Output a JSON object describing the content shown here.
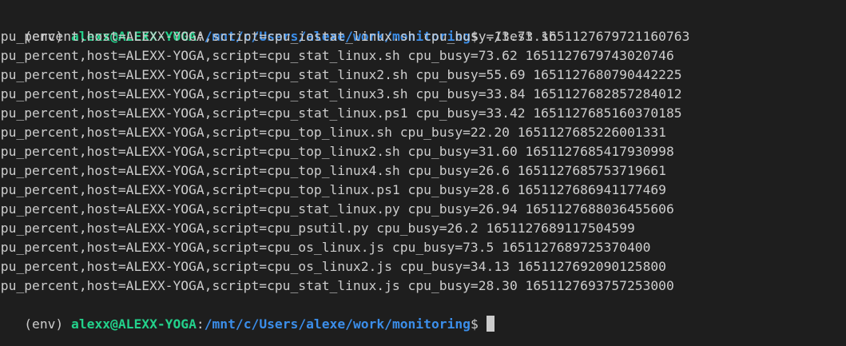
{
  "prompt": {
    "env": "(env)",
    "user_host": "alexx@ALEXX-YOGA",
    "colon": ":",
    "path": "/mnt/c/Users/alexe/work/monitoring",
    "dollar": "$",
    "command": " ./test.sh"
  },
  "output_lines": [
    "cpu_percent,host=ALEXX-YOGA,script=cpu_iostat_linux.sh cpu_busy=13.73 1651127679721160763",
    "cpu_percent,host=ALEXX-YOGA,script=cpu_stat_linux.sh cpu_busy=73.62 1651127679743020746",
    "cpu_percent,host=ALEXX-YOGA,script=cpu_stat_linux2.sh cpu_busy=55.69 1651127680790442225",
    "cpu_percent,host=ALEXX-YOGA,script=cpu_stat_linux3.sh cpu_busy=33.84 1651127682857284012",
    "cpu_percent,host=ALEXX-YOGA,script=cpu_stat_linux.ps1 cpu_busy=33.42 1651127685160370185",
    "cpu_percent,host=ALEXX-YOGA,script=cpu_top_linux.sh cpu_busy=22.20 1651127685226001331",
    "cpu_percent,host=ALEXX-YOGA,script=cpu_top_linux2.sh cpu_busy=31.60 1651127685417930998",
    "cpu_percent,host=ALEXX-YOGA,script=cpu_top_linux4.sh cpu_busy=26.6 1651127685753719661",
    "cpu_percent,host=ALEXX-YOGA,script=cpu_top_linux.ps1 cpu_busy=28.6 1651127686941177469",
    "cpu_percent,host=ALEXX-YOGA,script=cpu_stat_linux.py cpu_busy=26.94 1651127688036455606",
    "cpu_percent,host=ALEXX-YOGA,script=cpu_psutil.py cpu_busy=26.2 1651127689117504599",
    "cpu_percent,host=ALEXX-YOGA,script=cpu_os_linux.js cpu_busy=73.5 1651127689725370400",
    "cpu_percent,host=ALEXX-YOGA,script=cpu_os_linux2.js cpu_busy=34.13 1651127692090125800",
    "cpu_percent,host=ALEXX-YOGA,script=cpu_stat_linux.js cpu_busy=28.30 1651127693757253000"
  ],
  "colors": {
    "background": "#1e1e1e",
    "text": "#cccccc",
    "user_host": "#23d18b",
    "path": "#3b8eea"
  }
}
